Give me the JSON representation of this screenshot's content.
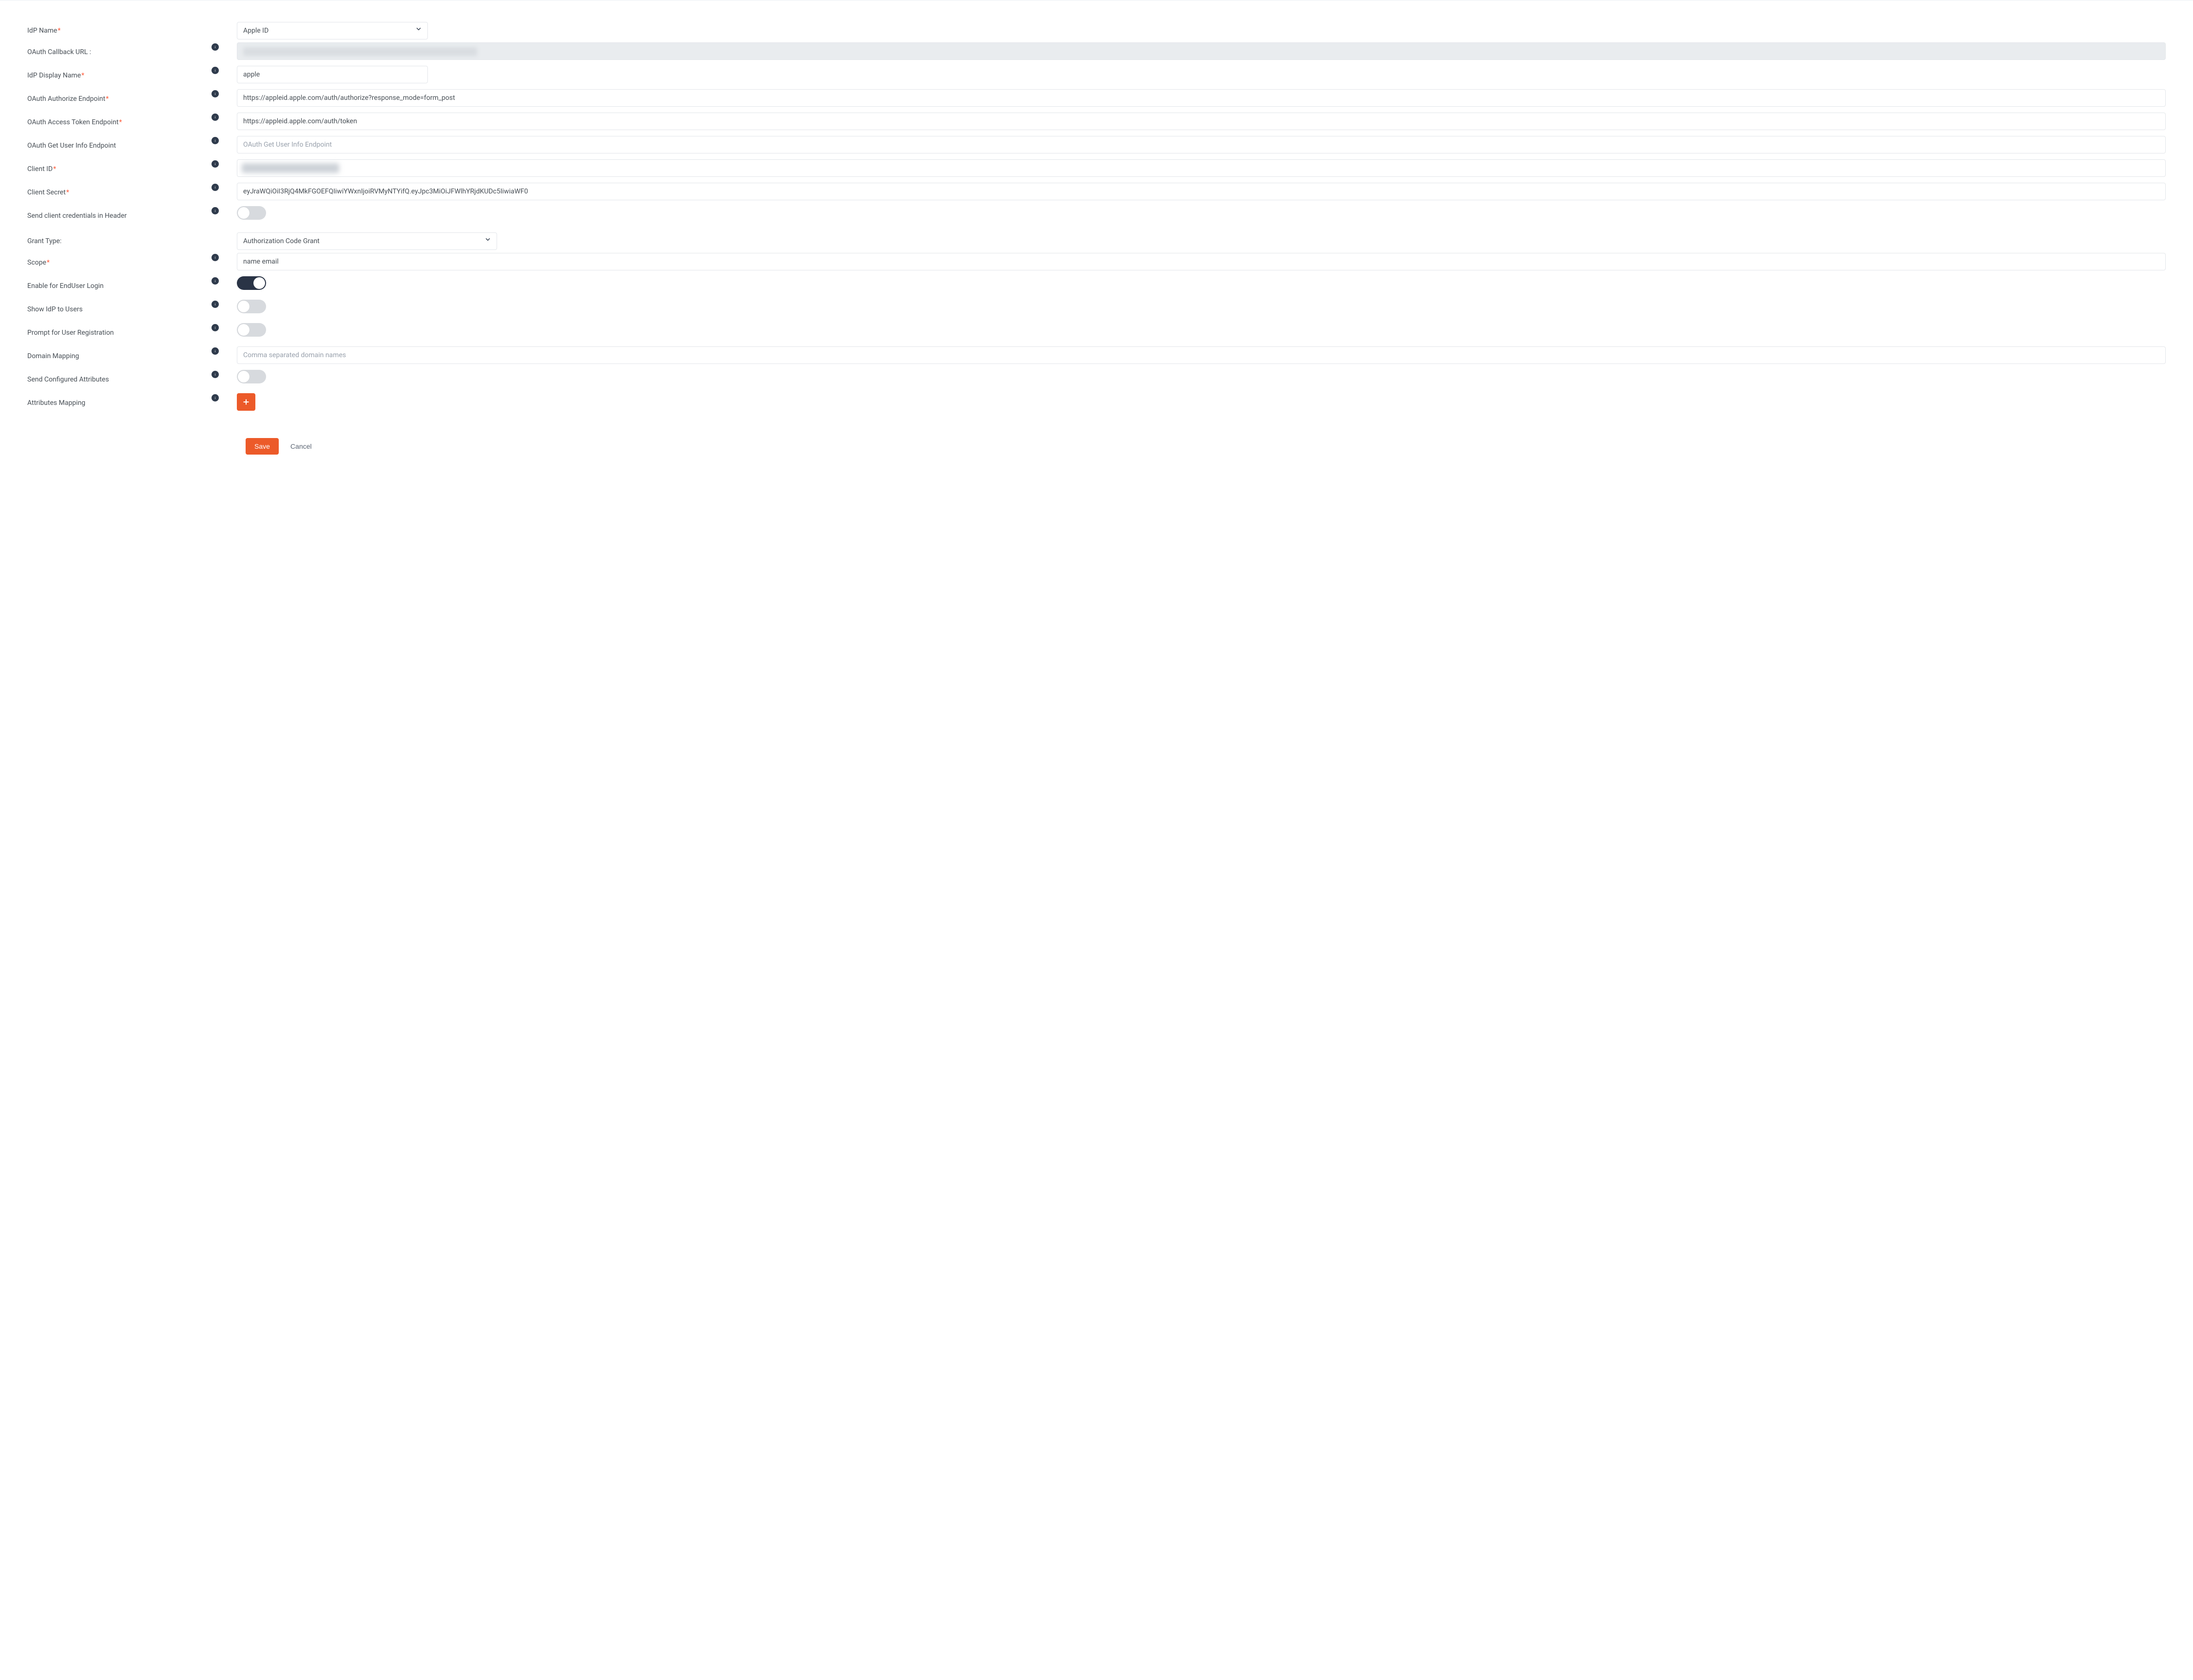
{
  "labels": {
    "idp_name": "IdP Name",
    "callback": "OAuth Callback URL :",
    "display_name": "IdP Display Name",
    "authorize_ep": "OAuth Authorize Endpoint",
    "token_ep": "OAuth Access Token Endpoint",
    "userinfo_ep": "OAuth Get User Info Endpoint",
    "client_id": "Client ID",
    "client_secret": "Client Secret",
    "cred_header": "Send client credentials in Header",
    "grant_type": "Grant Type:",
    "scope": "Scope",
    "enduser_login": "Enable for EndUser Login",
    "show_idp": "Show IdP to Users",
    "prompt_reg": "Prompt for User Registration",
    "domain_mapping": "Domain Mapping",
    "send_attrs": "Send Configured Attributes",
    "attr_mapping": "Attributes Mapping"
  },
  "values": {
    "idp_name_selected": "Apple ID",
    "display_name": "apple",
    "authorize_ep": "https://appleid.apple.com/auth/authorize?response_mode=form_post",
    "token_ep": "https://appleid.apple.com/auth/token",
    "client_secret": "eyJraWQiOiI3RjQ4MkFGOEFQIiwiYWxnIjoiRVMyNTYifQ.eyJpc3MiOiJFWlhYRjdKUDc5IiwiaWF0",
    "grant_type_selected": "Authorization Code Grant",
    "scope": "name email"
  },
  "placeholders": {
    "userinfo_ep": "OAuth Get User Info Endpoint",
    "domain_mapping": "Comma separated domain names"
  },
  "toggles": {
    "cred_header": false,
    "enduser_login": true,
    "show_idp": false,
    "prompt_reg": false,
    "send_attrs": false
  },
  "actions": {
    "save": "Save",
    "cancel": "Cancel"
  },
  "colors": {
    "accent": "#ec5a29",
    "toggle_on": "#2a3446"
  }
}
